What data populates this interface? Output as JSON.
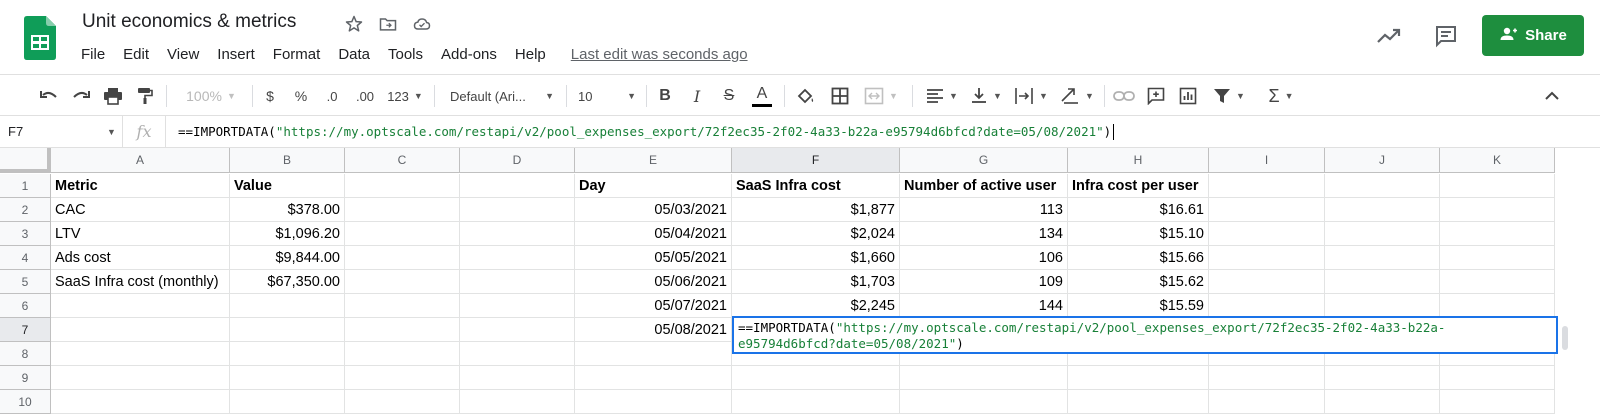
{
  "app": {
    "doc_title": "Unit economics & metrics",
    "brand_color": "#0f9d58",
    "menus": [
      "File",
      "Edit",
      "View",
      "Insert",
      "Format",
      "Data",
      "Tools",
      "Add-ons",
      "Help"
    ],
    "last_edit": "Last edit was seconds ago",
    "share_label": "Share",
    "share_color": "#1e8e3e",
    "title_icons": [
      "star-icon",
      "move-to-folder-icon",
      "cloud-status-icon"
    ],
    "header_icons": [
      "activity-trend-icon",
      "comment-history-icon"
    ]
  },
  "toolbar": {
    "zoom": "100%",
    "currency": "$",
    "percent": "%",
    "dec_decrease": ".0",
    "dec_increase": ".00",
    "more_formats": "123",
    "font_family": "Default (Ari...",
    "font_size": "10",
    "bold": "B",
    "italic": "I",
    "strikethrough": "S",
    "text_color": "A"
  },
  "formula_bar": {
    "name_box": "F7",
    "fx": "fx",
    "formula_prefix": "==IMPORTDATA(",
    "formula_string": "\"https://my.optscale.com/restapi/v2/pool_expenses_export/72f2ec35-2f02-4a33-b22a-e95794d6bfcd?date=05/08/2021\"",
    "formula_suffix": ")"
  },
  "grid": {
    "columns": [
      "A",
      "B",
      "C",
      "D",
      "E",
      "F",
      "G",
      "H",
      "I",
      "J",
      "K"
    ],
    "selected_column": "F",
    "rows": [
      "1",
      "2",
      "3",
      "4",
      "5",
      "6",
      "7",
      "8",
      "9",
      "10"
    ],
    "selected_row": "7",
    "metrics_table": {
      "headers": [
        "Metric",
        "Value"
      ],
      "rows": [
        [
          "CAC",
          "$378.00"
        ],
        [
          "LTV",
          "$1,096.20"
        ],
        [
          "Ads cost",
          "$9,844.00"
        ],
        [
          "SaaS Infra cost (monthly)",
          "$67,350.00"
        ]
      ]
    },
    "daily_table": {
      "headers": [
        "Day",
        "SaaS Infra cost",
        "Number of active user",
        "Infra cost per user"
      ],
      "rows": [
        [
          "05/03/2021",
          "$1,877",
          "113",
          "$16.61"
        ],
        [
          "05/04/2021",
          "$2,024",
          "134",
          "$15.10"
        ],
        [
          "05/05/2021",
          "$1,660",
          "106",
          "$15.66"
        ],
        [
          "05/06/2021",
          "$1,703",
          "109",
          "$15.62"
        ],
        [
          "05/07/2021",
          "$2,245",
          "144",
          "$15.59"
        ],
        [
          "05/08/2021",
          "",
          "",
          ""
        ]
      ]
    },
    "editor": {
      "prefix": "==IMPORTDATA(",
      "string_line1": "\"https://my.optscale.com/restapi/v2/pool_expenses_export/72f2ec35-2f02-4a33-b22a-",
      "string_line2": "e95794d6bfcd?date=05/08/2021\"",
      "suffix": ")"
    }
  }
}
